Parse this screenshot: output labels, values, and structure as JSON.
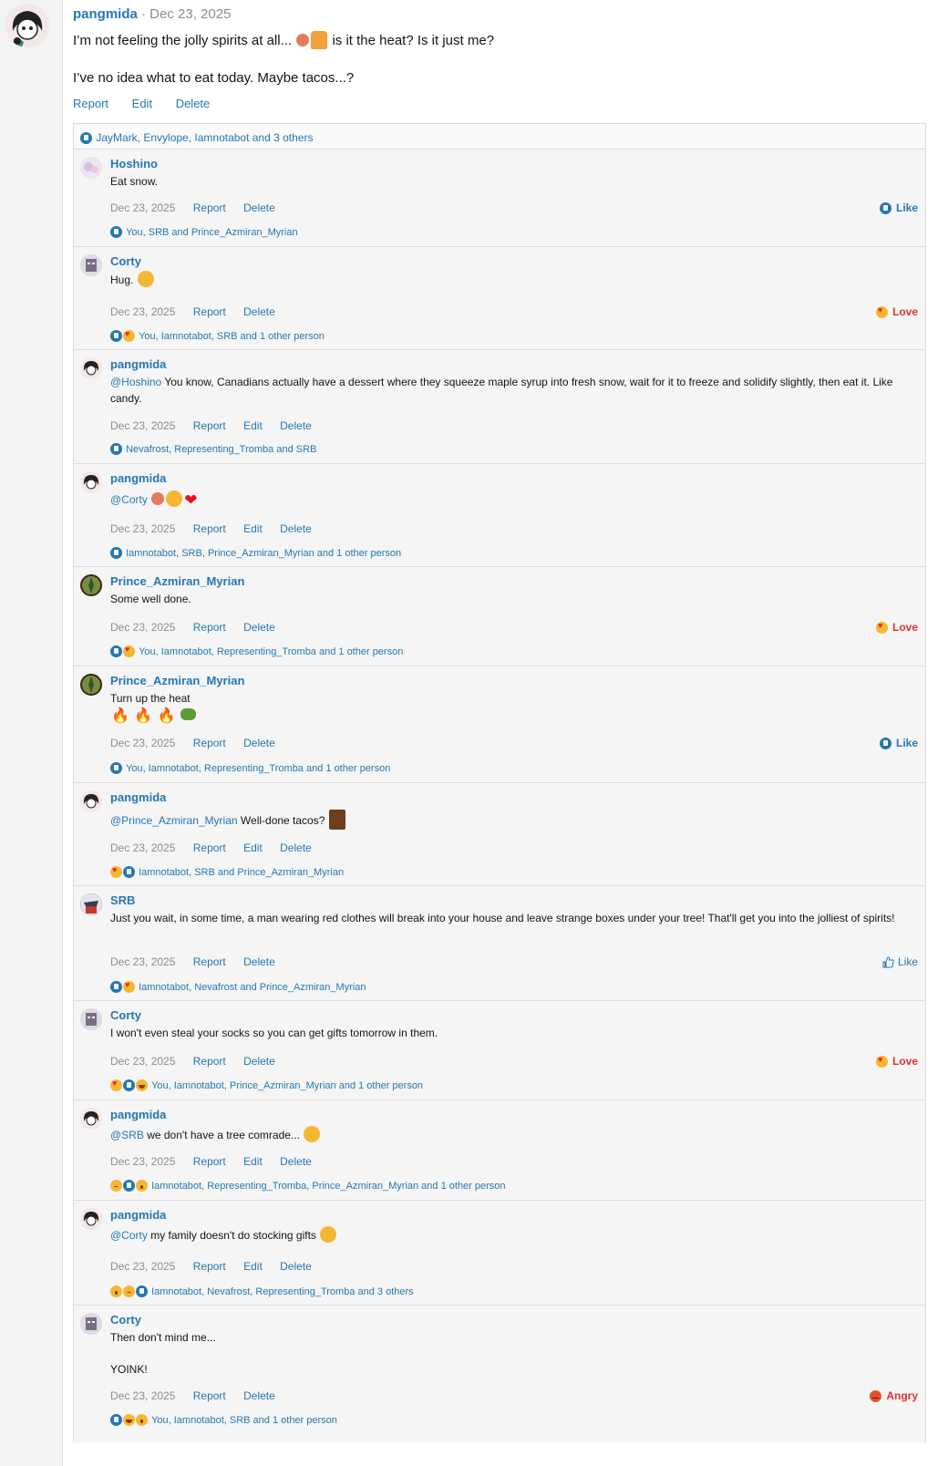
{
  "post": {
    "author": "pangmida",
    "date": "· Dec 23, 2025",
    "line1a": "I’m not feeling the jolly spirits at all...",
    "line1b": "is it the heat? Is it just me?",
    "line2": "I’ve no idea what to eat today. Maybe tacos...?",
    "actions": {
      "report": "Report",
      "edit": "Edit",
      "delete": "Delete"
    },
    "reactions_summary": "JayMark, Envylope, Iamnotabot and 3 others"
  },
  "comments": [
    {
      "author": "Hoshino",
      "mention": "",
      "text": "Eat snow.",
      "date": "Dec 23, 2025",
      "actions": [
        "Report",
        "Delete"
      ],
      "reaction_label": "Like",
      "summary": "You, SRB and Prince_Azmiran_Myrian"
    },
    {
      "author": "Corty",
      "mention": "",
      "text": "Hug.",
      "date": "Dec 23, 2025",
      "actions": [
        "Report",
        "Delete"
      ],
      "reaction_label": "Love",
      "summary": "You, Iamnotabot, SRB and 1 other person"
    },
    {
      "author": "pangmida",
      "mention": "@Hoshino",
      "text": "You know, Canadians actually have a dessert where they squeeze maple syrup into fresh snow, wait for it to freeze and solidify slightly, then eat it. Like candy.",
      "date": "Dec 23, 2025",
      "actions": [
        "Report",
        "Edit",
        "Delete"
      ],
      "reaction_label": "",
      "summary": "Nevafrost, Representing_Tromba and SRB"
    },
    {
      "author": "pangmida",
      "mention": "@Corty",
      "text": "",
      "date": "Dec 23, 2025",
      "actions": [
        "Report",
        "Edit",
        "Delete"
      ],
      "reaction_label": "",
      "summary": "Iamnotabot, SRB, Prince_Azmiran_Myrian and 1 other person"
    },
    {
      "author": "Prince_Azmiran_Myrian",
      "mention": "",
      "text": "Some well done.",
      "date": "Dec 23, 2025",
      "actions": [
        "Report",
        "Delete"
      ],
      "reaction_label": "Love",
      "summary": "You, Iamnotabot, Representing_Tromba and 1 other person"
    },
    {
      "author": "Prince_Azmiran_Myrian",
      "mention": "",
      "text": "Turn up the heat",
      "date": "Dec 23, 2025",
      "actions": [
        "Report",
        "Delete"
      ],
      "reaction_label": "Like",
      "summary": "You, Iamnotabot, Representing_Tromba and 1 other person"
    },
    {
      "author": "pangmida",
      "mention": "@Prince_Azmiran_Myrian",
      "text": "Well-done tacos?",
      "date": "Dec 23, 2025",
      "actions": [
        "Report",
        "Edit",
        "Delete"
      ],
      "reaction_label": "",
      "summary": "Iamnotabot, SRB and Prince_Azmiran_Myrian"
    },
    {
      "author": "SRB",
      "mention": "",
      "text": "Just you wait, in some time, a man wearing red clothes will break into your house and leave strange boxes under your tree! That'll get you into the jolliest of spirits!",
      "date": "Dec 23, 2025",
      "actions": [
        "Report",
        "Delete"
      ],
      "reaction_label": "Like",
      "summary": "Iamnotabot, Nevafrost and Prince_Azmiran_Myrian"
    },
    {
      "author": "Corty",
      "mention": "",
      "text": "I won't even steal your socks so you can get gifts tomorrow in them.",
      "date": "Dec 23, 2025",
      "actions": [
        "Report",
        "Delete"
      ],
      "reaction_label": "Love",
      "summary": "You, Iamnotabot, Prince_Azmiran_Myrian and 1 other person"
    },
    {
      "author": "pangmida",
      "mention": "@SRB",
      "text": "we don't have a tree comrade...",
      "date": "Dec 23, 2025",
      "actions": [
        "Report",
        "Edit",
        "Delete"
      ],
      "reaction_label": "",
      "summary": "Iamnotabot, Representing_Tromba, Prince_Azmiran_Myrian and 1 other person"
    },
    {
      "author": "pangmida",
      "mention": "@Corty",
      "text": "my family doesn't do stocking gifts",
      "date": "Dec 23, 2025",
      "actions": [
        "Report",
        "Edit",
        "Delete"
      ],
      "reaction_label": "",
      "summary": "Iamnotabot, Nevafrost, Representing_Tromba and 3 others"
    },
    {
      "author": "Corty",
      "mention": "",
      "text": "Then don't mind me...",
      "text2": "YOINK!",
      "date": "Dec 23, 2025",
      "actions": [
        "Report",
        "Delete"
      ],
      "reaction_label": "Angry",
      "summary": "You, Iamnotabot, SRB and 1 other person"
    }
  ]
}
